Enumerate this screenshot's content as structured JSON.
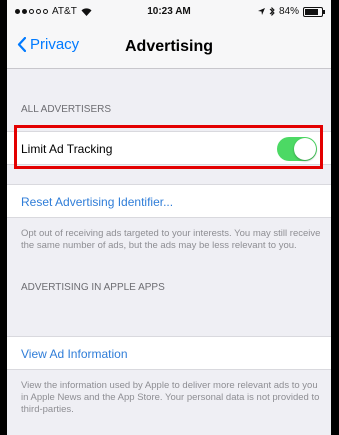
{
  "status_bar": {
    "carrier": "AT&T",
    "time": "10:23 AM",
    "battery": "84%",
    "icons": [
      "signal-dots-icon",
      "wifi-icon",
      "location-icon",
      "bluetooth-icon",
      "battery-icon"
    ]
  },
  "nav": {
    "back_label": "Privacy",
    "title": "Advertising"
  },
  "sections": {
    "all_advertisers": {
      "header": "ALL ADVERTISERS",
      "limit_ad_tracking_label": "Limit Ad Tracking",
      "limit_ad_tracking_on": true,
      "reset_link": "Reset Advertising Identifier...",
      "footer": "Opt out of receiving ads targeted to your interests. You may still receive the same number of ads, but the ads may be less relevant to you."
    },
    "apple_apps": {
      "header": "ADVERTISING IN APPLE APPS",
      "view_link": "View Ad Information",
      "footer": "View the information used by Apple to deliver more relevant ads to you in Apple News and the App Store. Your personal data is not provided to third-parties."
    }
  },
  "colors": {
    "accent": "#007aff",
    "toggle_on": "#4cd964",
    "highlight": "#e30000",
    "background": "#efeff4"
  }
}
